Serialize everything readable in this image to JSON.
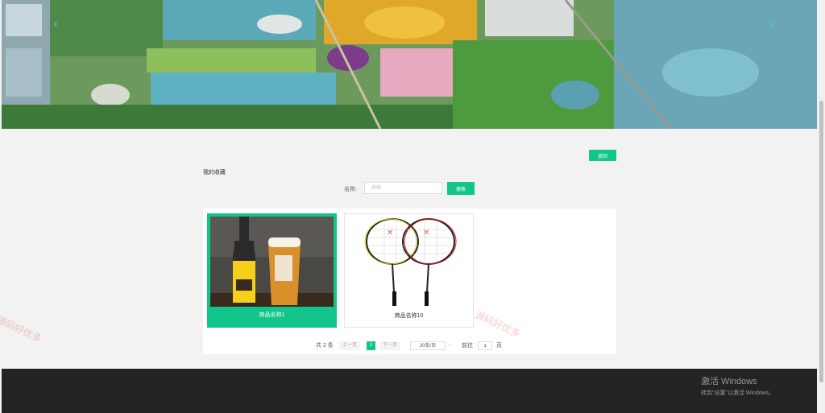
{
  "banner": {
    "image_name": "aerial-park-landscape",
    "prev_icon": "chevron-left-icon",
    "next_icon": "chevron-right-icon",
    "prev_glyph": "‹",
    "next_glyph": "›"
  },
  "back_label": "返回",
  "section_title": "我的收藏",
  "search": {
    "label": "名称:",
    "placeholder": "名称",
    "value": "",
    "button": "搜索"
  },
  "products": [
    {
      "name": "商品名称1",
      "image": "beer-bottle-and-glass",
      "selected": true
    },
    {
      "name": "商品名称10",
      "image": "badminton-rackets",
      "selected": false
    }
  ],
  "pagination": {
    "total": "共 2 条",
    "prev": "上一页",
    "current": "1",
    "next": "下一页",
    "page_size": "20条/页",
    "goto_label": "前往",
    "goto_value": "1",
    "page_unit": "页"
  },
  "watermark": "源码好优多",
  "activation": {
    "title": "激活 Windows",
    "subtitle": "转到\"设置\"以激活 Windows。"
  },
  "colors": {
    "accent": "#12c58a",
    "footer": "#232323",
    "background": "#f2f2f2"
  }
}
